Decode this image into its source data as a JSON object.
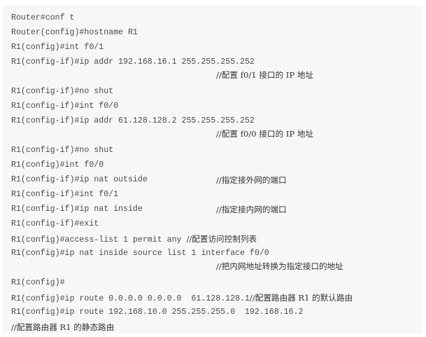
{
  "lines": [
    {
      "code": "Router#conf t"
    },
    {
      "code": "Router(config)#hostname R1"
    },
    {
      "code": "R1(config)#int f0/1"
    },
    {
      "code": "R1(config-if)#ip addr 192.168.16.1 255.255.255.252"
    },
    {
      "comment": "//配置 f0/1 接口的 IP 地址"
    },
    {
      "code": "R1(config-if)#no shut"
    },
    {
      "code": "R1(config-if)#int f0/0"
    },
    {
      "code": "R1(config-if)#ip addr 61.128.128.2 255.255.255.252"
    },
    {
      "comment": "//配置 f0/0 接口的 IP 地址"
    },
    {
      "code": "R1(config-if)#no shut"
    },
    {
      "code": "R1(config)#int f0/0"
    },
    {
      "code": "R1(config-if)#ip nat outside",
      "comment": "//指定接外网的端口"
    },
    {
      "code": "R1(config-if)#int f0/1"
    },
    {
      "code": "R1(config-if)#ip nat inside",
      "comment": "//指定接内网的端口"
    },
    {
      "code": "R1(config-if)#exit"
    },
    {
      "code": "R1(config)#access-list 1 permit any ",
      "comment": "//配置访问控制列表"
    },
    {
      "code": "R1(config)#ip nat inside source list 1 interface f0/0"
    },
    {
      "comment": "//把内网地址转换为指定接口的地址"
    },
    {
      "code": "R1(config)#"
    },
    {
      "code": "R1(config)#ip route 0.0.0.0 0.0.0.0  61.128.128.1",
      "comment": "//配置路由器 R1 的默认路由"
    },
    {
      "code": "R1(config)#ip route 192.168.10.0 255.255.255.0  192.168.16.2"
    },
    {
      "comment": "//配置路由器 R1 的静态路由"
    }
  ]
}
